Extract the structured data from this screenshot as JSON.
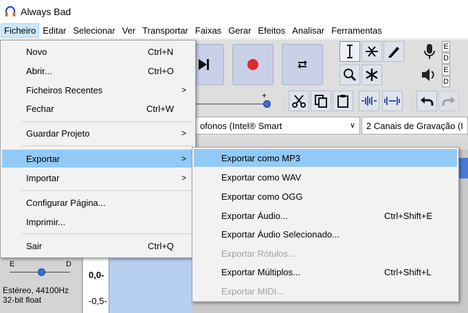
{
  "window": {
    "title": "Always Bad"
  },
  "menubar": {
    "items": [
      "Ficheiro",
      "Editar",
      "Selecionar",
      "Ver",
      "Transportar",
      "Faixas",
      "Gerar",
      "Efeitos",
      "Analisar",
      "Ferramentas"
    ]
  },
  "background": {
    "meter_letters": [
      "E",
      "D",
      "E",
      "D"
    ],
    "slider_plus": "+",
    "playback_device": "ofonos (Intel® Smart",
    "recording_channels": "2 Canais de Gravação (I",
    "track": {
      "left_label": "E",
      "right_label": "D",
      "format_line1": "Estéreo, 44100Hz",
      "format_line2": "32-bit float",
      "scale_top": "0,0-",
      "scale_bottom": "-0,5-"
    }
  },
  "file_menu": {
    "items": [
      {
        "label": "Novo",
        "shortcut": "Ctrl+N"
      },
      {
        "label": "Abrir...",
        "shortcut": "Ctrl+O"
      },
      {
        "label": "Ficheiros Recentes",
        "shortcut": ""
      },
      {
        "label": "Fechar",
        "shortcut": "Ctrl+W"
      },
      {
        "label": "Guardar Projeto",
        "shortcut": ""
      },
      {
        "label": "Exportar",
        "shortcut": ""
      },
      {
        "label": "Importar",
        "shortcut": ""
      },
      {
        "label": "Configurar Página...",
        "shortcut": ""
      },
      {
        "label": "Imprimir...",
        "shortcut": ""
      },
      {
        "label": "Sair",
        "shortcut": "Ctrl+Q"
      }
    ],
    "submenu_arrow": ">"
  },
  "export_menu": {
    "items": [
      {
        "label": "Exportar como MP3",
        "shortcut": "",
        "enabled": true
      },
      {
        "label": "Exportar como WAV",
        "shortcut": "",
        "enabled": true
      },
      {
        "label": "Exportar como OGG",
        "shortcut": "",
        "enabled": true
      },
      {
        "label": "Exportar Áudio...",
        "shortcut": "Ctrl+Shift+E",
        "enabled": true
      },
      {
        "label": "Exportar Áudio Selecionado...",
        "shortcut": "",
        "enabled": true
      },
      {
        "label": "Exportar Rótulos...",
        "shortcut": "",
        "enabled": false
      },
      {
        "label": "Exportar Múltiplos...",
        "shortcut": "Ctrl+Shift+L",
        "enabled": true
      },
      {
        "label": "Exportar MIDI...",
        "shortcut": "",
        "enabled": false
      }
    ]
  },
  "colors": {
    "menu_highlight": "#91c9f7",
    "menubar_active": "#cce8ff",
    "record_red": "#e0282e",
    "disabled_text": "#a0a0a0"
  }
}
